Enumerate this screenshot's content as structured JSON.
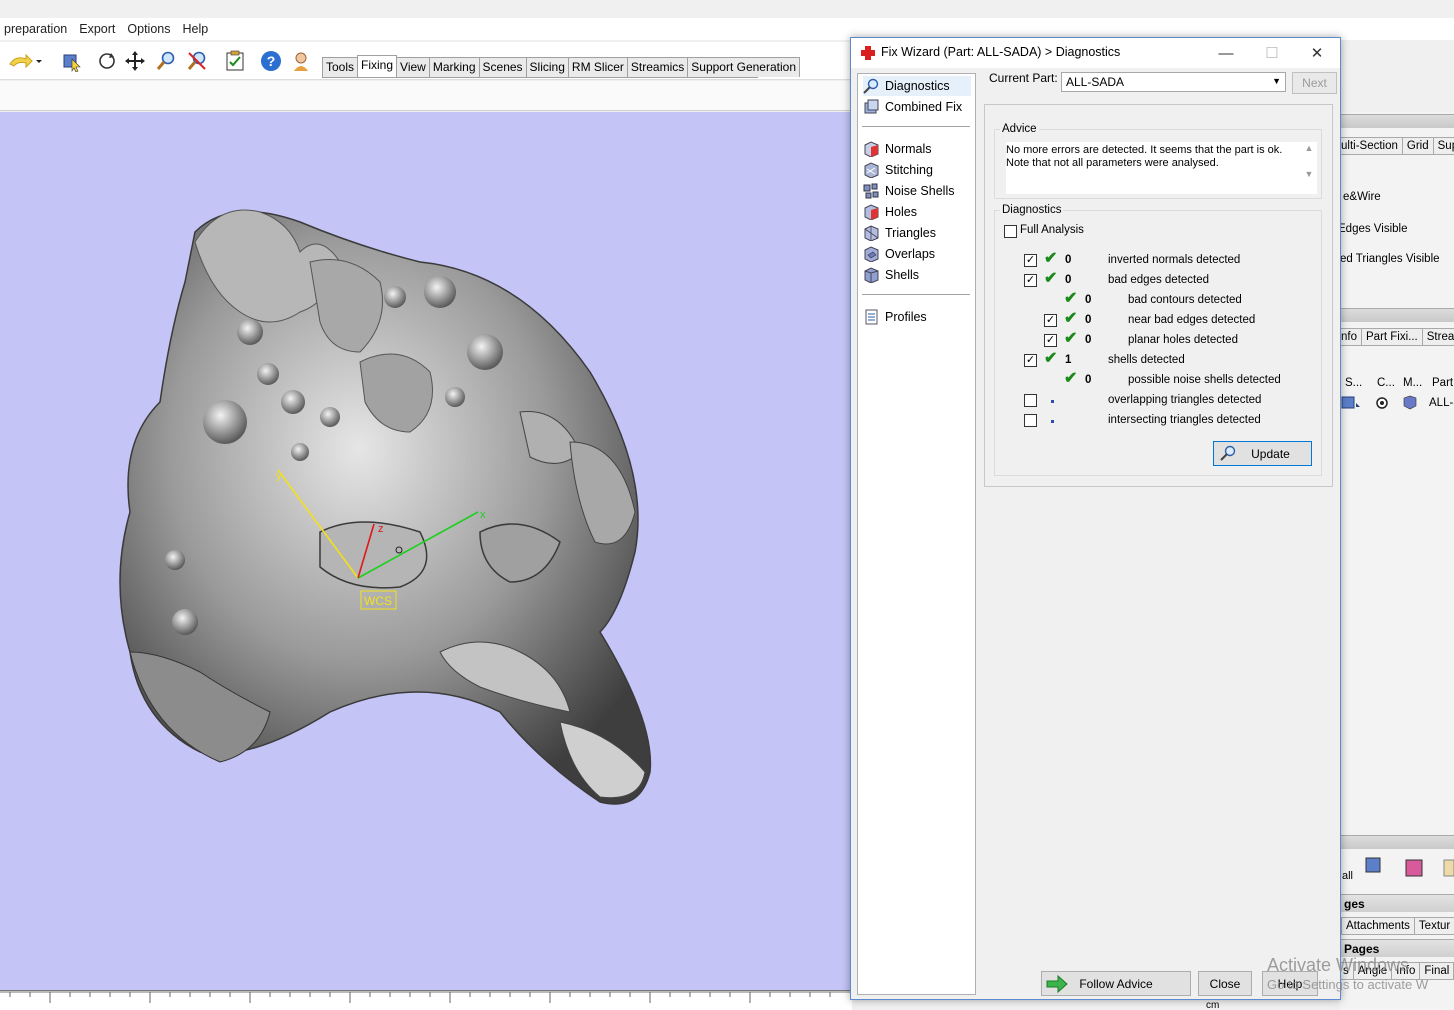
{
  "menu": [
    "preparation",
    "Export",
    "Options",
    "Help"
  ],
  "tabs": [
    "Tools",
    "Fixing",
    "View",
    "Marking",
    "Scenes",
    "Slicing",
    "RM Slicer",
    "Streamics",
    "Support Generation"
  ],
  "active_tab": "Fixing",
  "viewport": {
    "wcs_label": "WCS",
    "axis_x": "x",
    "axis_y": "y",
    "axis_z": "z"
  },
  "right_panel": {
    "tabs_top": [
      "ulti-Section",
      "Grid",
      "Sup"
    ],
    "labels": [
      "e&Wire",
      "Edges Visible",
      "ed Triangles Visible"
    ],
    "tabs_mid": [
      "nfo",
      "Part Fixi...",
      "Strea"
    ],
    "columns": [
      "S...",
      "C...",
      "M...",
      "Part"
    ],
    "part_value": "ALL-S",
    "section1": "ges",
    "tabs_bottom1": [
      "Attachments",
      "Textur"
    ],
    "section2": "Pages",
    "tabs_bottom2": [
      "s",
      "Angle",
      "Info",
      "Final"
    ],
    "unit": "cm"
  },
  "dialog": {
    "title": "Fix Wizard (Part: ALL-SADA) > Diagnostics",
    "nav": {
      "group1": [
        "Diagnostics",
        "Combined Fix"
      ],
      "group2": [
        "Normals",
        "Stitching",
        "Noise Shells",
        "Holes",
        "Triangles",
        "Overlaps",
        "Shells"
      ],
      "group3": [
        "Profiles"
      ]
    },
    "current_part_label": "Current Part:",
    "current_part_value": "ALL-SADA",
    "next_label": "Next",
    "advice_title": "Advice",
    "advice_text_1": "No more errors are detected. It seems that the part is ok.",
    "advice_text_2": "Note that not all parameters were analysed.",
    "diagnostics_title": "Diagnostics",
    "full_analysis_label": "Full Analysis",
    "rows": [
      {
        "checked": true,
        "status": "ok",
        "value": "0",
        "label": "inverted normals detected"
      },
      {
        "checked": true,
        "status": "ok",
        "value": "0",
        "label": "bad edges detected"
      },
      {
        "checked": null,
        "status": "ok",
        "value": "0",
        "label": "bad contours detected"
      },
      {
        "checked": true,
        "status": "ok",
        "value": "0",
        "label": "near bad edges detected"
      },
      {
        "checked": true,
        "status": "ok",
        "value": "0",
        "label": "planar holes detected"
      },
      {
        "checked": true,
        "status": "ok",
        "value": "1",
        "label": "shells detected"
      },
      {
        "checked": null,
        "status": "ok",
        "value": "0",
        "label": "possible noise shells detected"
      },
      {
        "checked": false,
        "status": "none",
        "value": "",
        "label": "overlapping triangles detected"
      },
      {
        "checked": false,
        "status": "none",
        "value": "",
        "label": "intersecting triangles detected"
      }
    ],
    "update_label": "Update",
    "follow_advice_label": "Follow Advice",
    "close_label": "Close",
    "help_label": "Help"
  },
  "watermark": {
    "line1": "Activate Windows",
    "line2": "Go to Settings to activate W"
  }
}
